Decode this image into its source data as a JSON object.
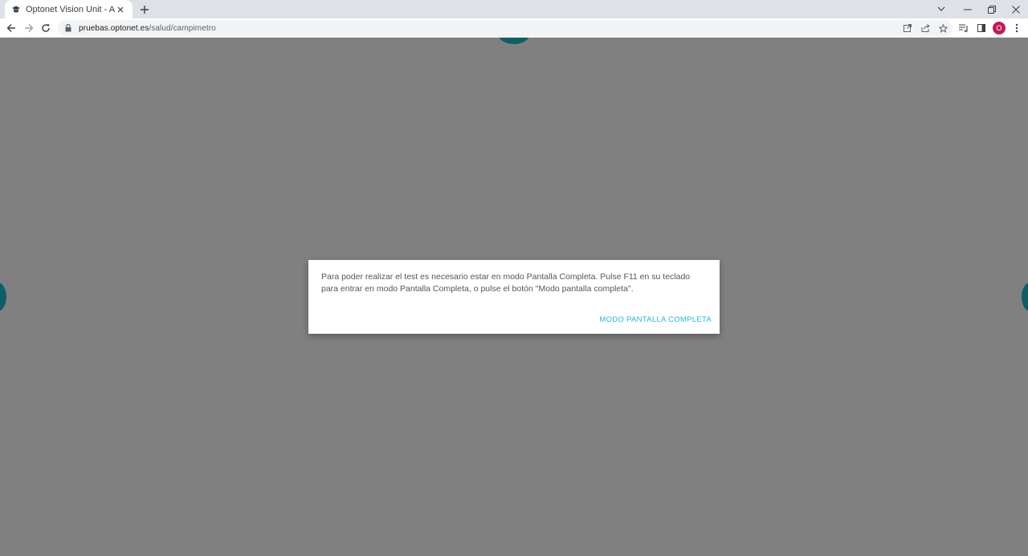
{
  "browser": {
    "tab_title": "Optonet Vision Unit - App",
    "url_host": "pruebas.optonet.es",
    "url_path": "/salud/campimetro",
    "profile_initial": "O"
  },
  "dialog": {
    "message": "Para poder realizar el test es necesario estar en modo Pantalla Completa. Pulse F11 en su teclado para entrar en modo Pantalla Completa, o pulse el botón \"Modo pantalla completa\".",
    "button_label": "MODO PANTALLA COMPLETA"
  },
  "colors": {
    "page_background": "#808080",
    "target": "#0e5e66",
    "accent": "#26b8d9",
    "avatar": "#c2185b"
  }
}
